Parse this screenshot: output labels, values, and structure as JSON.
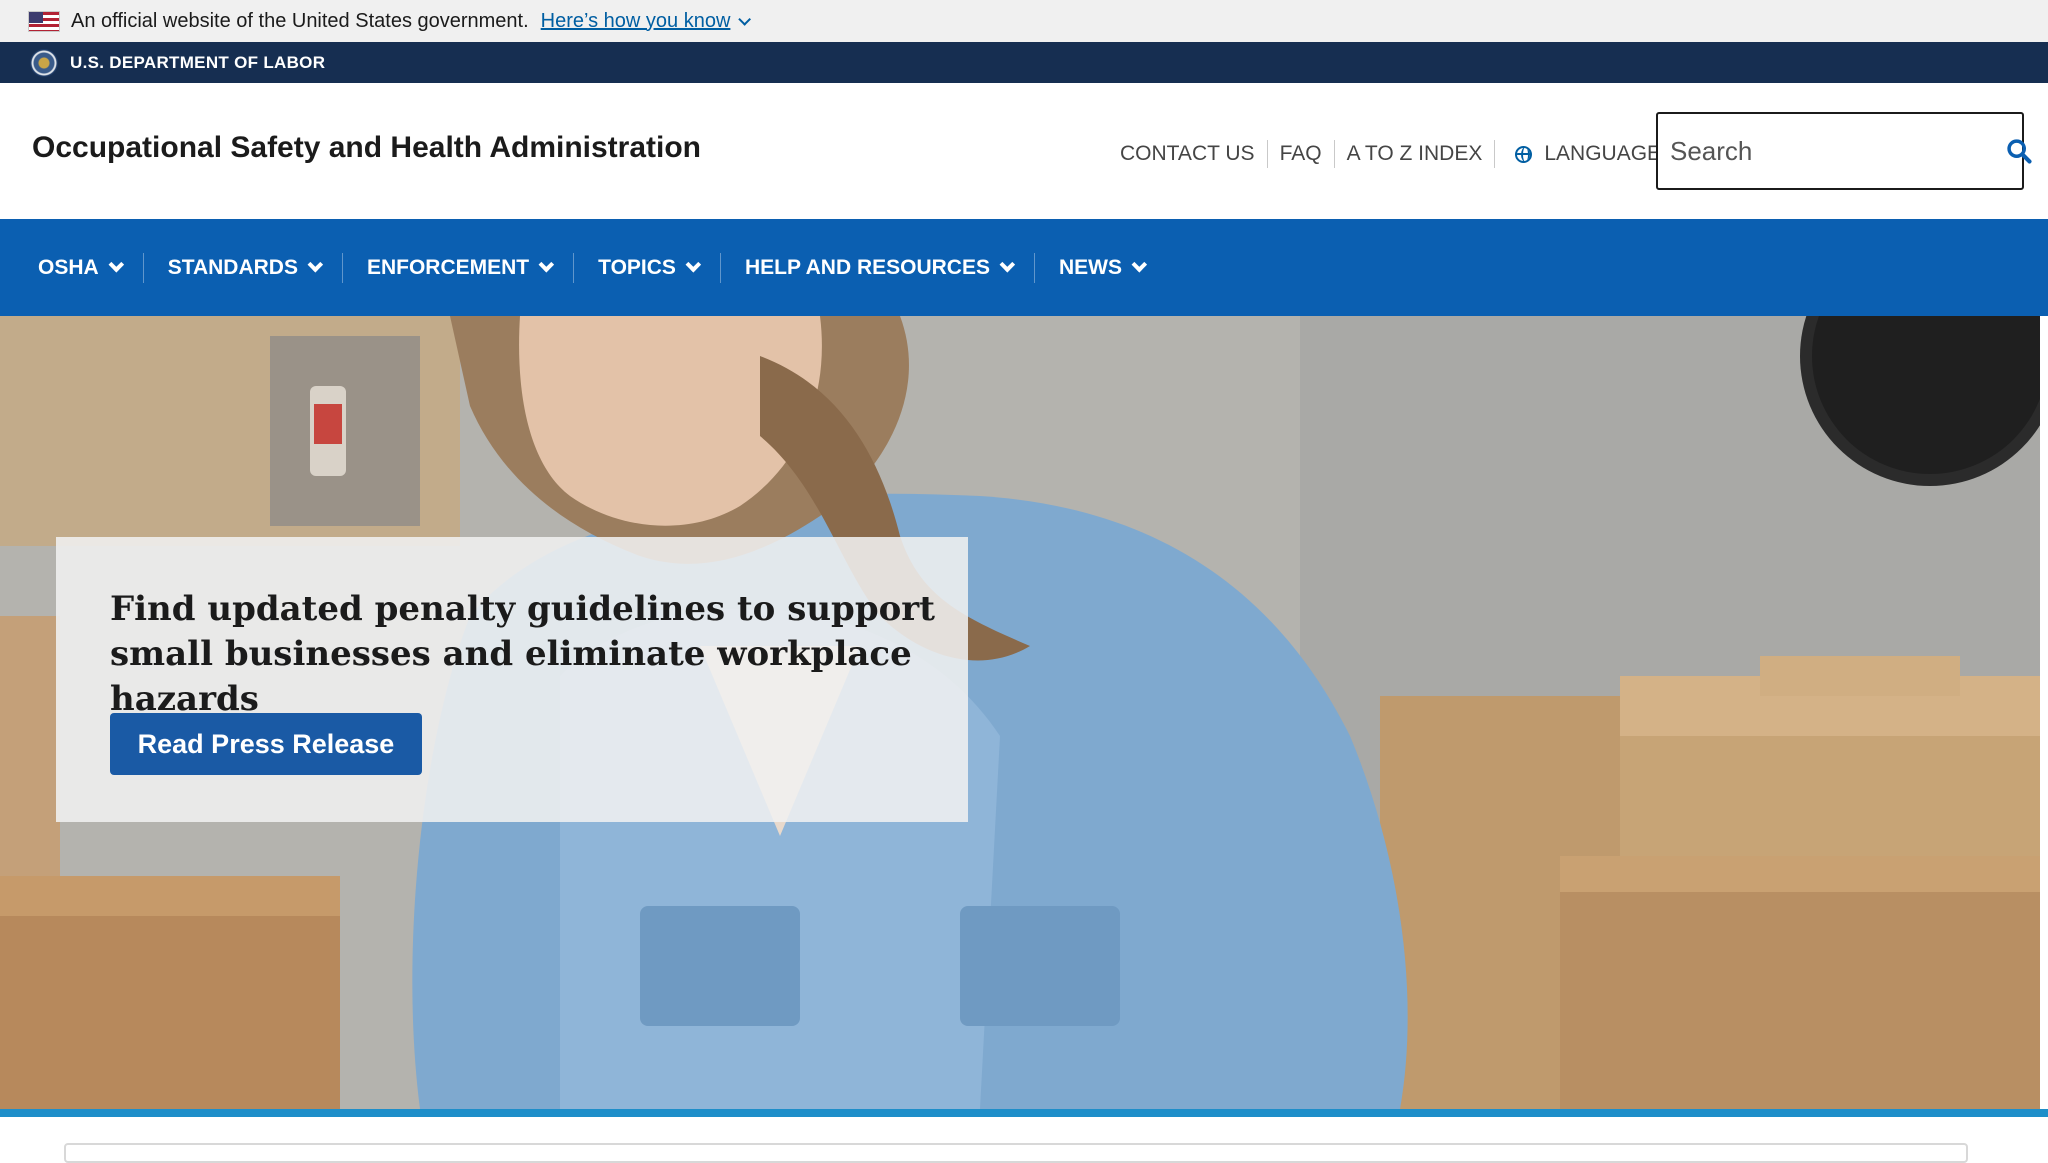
{
  "gov_banner": {
    "text": "An official website of the United States government.",
    "link_label": "Here’s how you know"
  },
  "dol_bar": {
    "label": "U.S. DEPARTMENT OF LABOR"
  },
  "header": {
    "agency_title": "Occupational Safety and Health Administration",
    "utility_nav": {
      "contact": "CONTACT US",
      "faq": "FAQ",
      "az_index": "A TO Z INDEX",
      "languages": "LANGUAGES"
    },
    "search": {
      "placeholder": "Search",
      "value": ""
    }
  },
  "main_nav": {
    "items": [
      {
        "label": "OSHA"
      },
      {
        "label": "STANDARDS"
      },
      {
        "label": "ENFORCEMENT"
      },
      {
        "label": "TOPICS"
      },
      {
        "label": "HELP AND RESOURCES"
      },
      {
        "label": "NEWS"
      }
    ]
  },
  "hero": {
    "headline": "Find updated penalty guidelines to support small businesses and eliminate workplace hazards",
    "button_label": "Read Press Release"
  },
  "colors": {
    "gov_banner_bg": "#f0f0f0",
    "dol_bar_bg": "#162e51",
    "nav_bg": "#0b5fb1",
    "link": "#005ea2",
    "button_bg": "#1a5aa5",
    "accent": "#1e8ec9"
  },
  "icons": {
    "flag": "us-flag-icon",
    "seal": "dol-seal-icon",
    "globe": "globe-icon",
    "search": "search-icon",
    "chevron": "chevron-down-icon"
  }
}
